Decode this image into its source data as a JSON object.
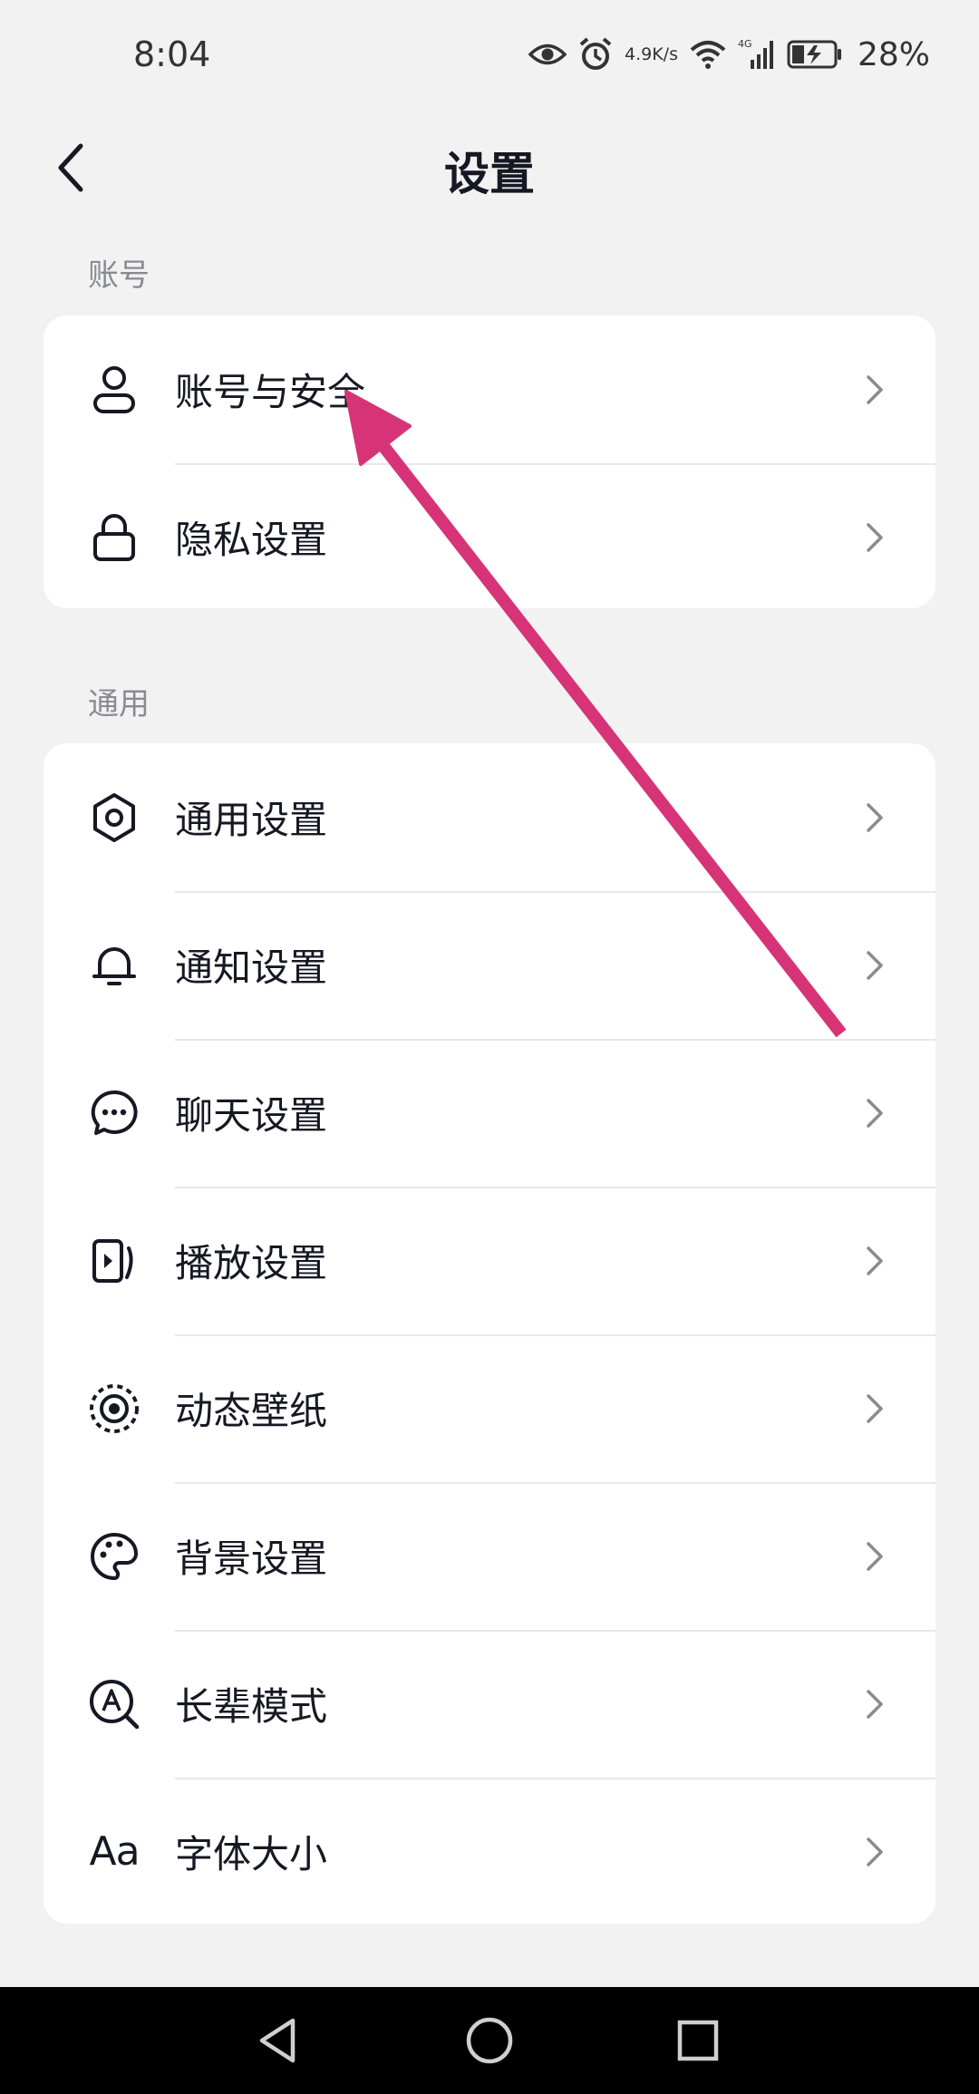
{
  "status_bar": {
    "time": "8:04",
    "net_speed_value": "4.9",
    "net_speed_unit": "K/s",
    "network_type": "4G",
    "battery": "28%",
    "icons": [
      "eye-icon",
      "alarm-icon",
      "wifi-icon",
      "signal-icon",
      "battery-charging-icon"
    ]
  },
  "header": {
    "title": "设置",
    "back_icon": "chevron-left-icon"
  },
  "sections": {
    "account": {
      "label": "账号",
      "items": [
        {
          "label": "账号与安全",
          "icon": "user-icon"
        },
        {
          "label": "隐私设置",
          "icon": "lock-icon"
        }
      ]
    },
    "general": {
      "label": "通用",
      "items": [
        {
          "label": "通用设置",
          "icon": "gear-icon"
        },
        {
          "label": "通知设置",
          "icon": "bell-icon"
        },
        {
          "label": "聊天设置",
          "icon": "chat-bubble-icon"
        },
        {
          "label": "播放设置",
          "icon": "play-card-icon"
        },
        {
          "label": "动态壁纸",
          "icon": "dynamic-wallpaper-icon"
        },
        {
          "label": "背景设置",
          "icon": "palette-icon"
        },
        {
          "label": "长辈模式",
          "icon": "elder-mode-icon"
        },
        {
          "label": "字体大小",
          "icon": "font-size-icon",
          "icon_text": "Aa"
        }
      ]
    }
  },
  "annotation": {
    "type": "arrow",
    "color": "#d63477",
    "points_to": "账号与安全"
  },
  "nav_bar": {
    "buttons": [
      "back-triangle-icon",
      "home-circle-icon",
      "recents-square-icon"
    ]
  },
  "colors": {
    "background": "#f2f2f2",
    "card": "#ffffff",
    "text": "#161823",
    "secondary": "#8a8b91"
  }
}
